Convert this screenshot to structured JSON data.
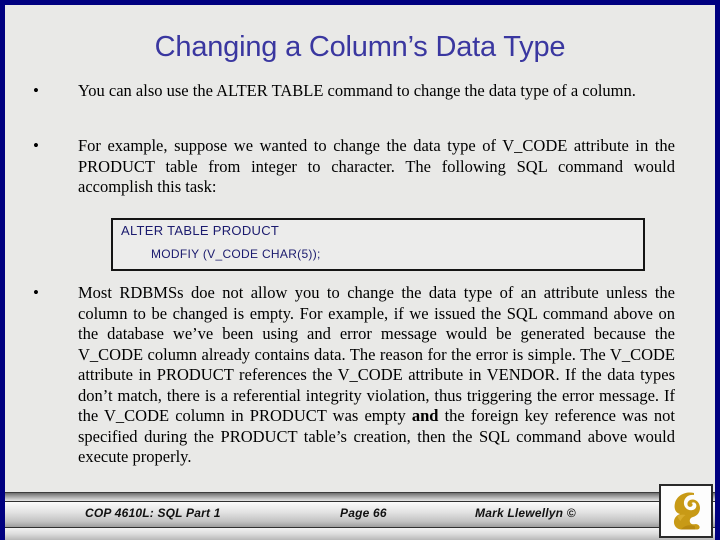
{
  "slide": {
    "title": "Changing a Column’s Data Type",
    "title_color": "#3a37a0",
    "background_color": "#e9e9e7",
    "border_color": "#000080",
    "bullet_glyph": "•"
  },
  "bullets": [
    {
      "id": "bullet-1",
      "text": "You can also use the ALTER TABLE command to change the data type of a column."
    },
    {
      "id": "bullet-2",
      "text": "For example, suppose we wanted to change the data type of V_CODE attribute in the PRODUCT table from integer to character.  The following SQL command would accomplish this task:"
    },
    {
      "id": "bullet-3",
      "text_before_bold": "Most RDBMSs doe not allow you to change the data type of an attribute unless the column to be changed is empty.  For example, if we issued the SQL command above on the database we’ve been using and error message would be generated because the V_CODE column already contains data.  The reason for the error is simple.  The V_CODE attribute in PRODUCT references the V_CODE attribute in VENDOR.  If the data types don’t match, there is a referential integrity violation, thus triggering the error message.  If the V_CODE column in PRODUCT was empty ",
      "bold_word": "and",
      "text_after_bold": " the foreign key reference was not specified during the PRODUCT table’s creation, then the SQL command above would execute properly."
    }
  ],
  "code_box": {
    "line1": "ALTER TABLE  PRODUCT",
    "line2": "MODFIY (V_CODE CHAR(5));",
    "text_color": "#1b1b6e"
  },
  "footer": {
    "course": "COP 4610L: SQL Part 1",
    "page": "Page 66",
    "author": "Mark Llewellyn ©",
    "logo_name": "ucf-pegasus-logo",
    "logo_color": "#c89a16"
  }
}
